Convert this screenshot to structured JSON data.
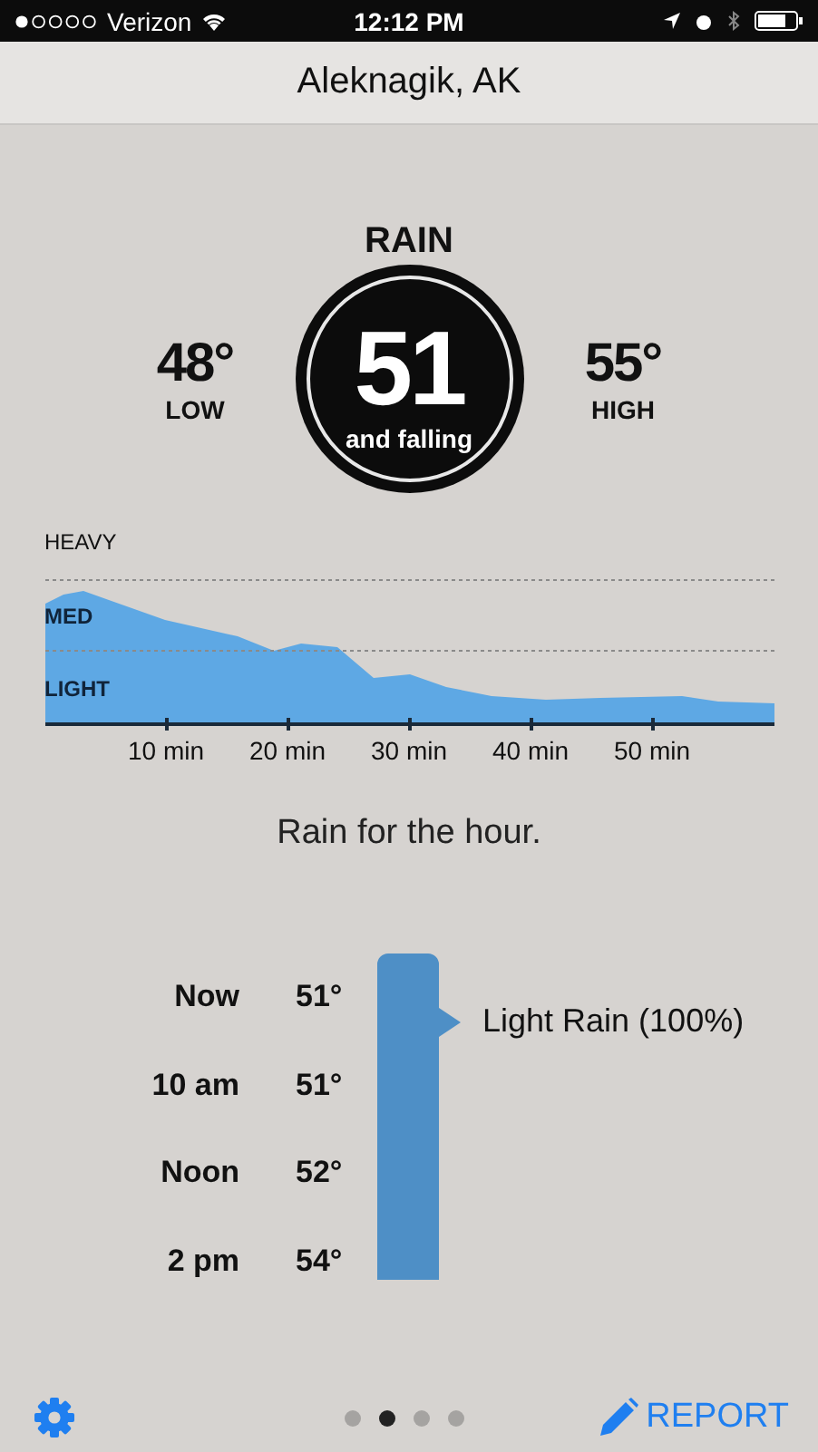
{
  "status_bar": {
    "carrier": "Verizon",
    "time": "12:12 PM"
  },
  "header": {
    "title": "Aleknagik, AK"
  },
  "current": {
    "condition": "RAIN",
    "temperature": "51",
    "trend": "and falling",
    "low": {
      "value": "48°",
      "label": "LOW"
    },
    "high": {
      "value": "55°",
      "label": "HIGH"
    }
  },
  "intensity": {
    "levels": [
      "HEAVY",
      "MED",
      "LIGHT"
    ],
    "ticks": [
      "10 min",
      "20 min",
      "30 min",
      "40 min",
      "50 min"
    ]
  },
  "summary": "Rain for the hour.",
  "hourly": [
    {
      "time": "Now",
      "temp": "51°"
    },
    {
      "time": "10 am",
      "temp": "51°"
    },
    {
      "time": "Noon",
      "temp": "52°"
    },
    {
      "time": "2 pm",
      "temp": "54°"
    }
  ],
  "forecast_label": "Light Rain (100%)",
  "pages": [
    {
      "selected": false
    },
    {
      "selected": true
    },
    {
      "selected": false
    },
    {
      "selected": false
    }
  ],
  "report_button": "REPORT"
}
